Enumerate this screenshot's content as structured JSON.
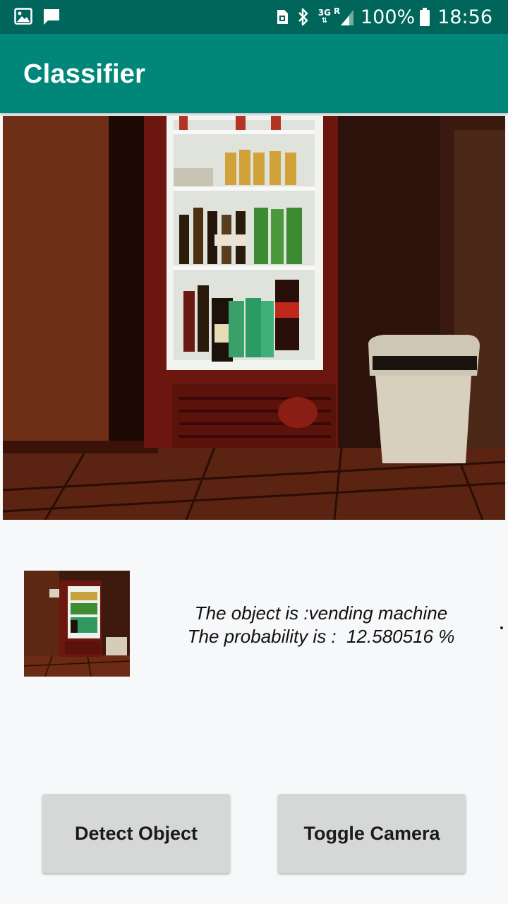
{
  "status_bar": {
    "left_icons": [
      "image-icon",
      "message-icon"
    ],
    "right_icons": [
      "sim-icon",
      "bluetooth-icon",
      "network-3g-icon",
      "signal-icon",
      "battery-icon"
    ],
    "network_type": "3G",
    "roaming": "R",
    "battery": "100%",
    "time": "18:56",
    "colors": {
      "background": "#00665b",
      "text": "#ffffff"
    }
  },
  "app_bar": {
    "title": "Classifier",
    "color": "#00877a"
  },
  "camera": {
    "description_icon": "camera-preview"
  },
  "result": {
    "object_line": "The object is :vending machine",
    "probability_line": "The probability is :  12.580516 %",
    "object_label": "vending machine",
    "probability_percent": 12.580516
  },
  "buttons": {
    "detect_label": "Detect Object",
    "toggle_label": "Toggle Camera",
    "color": "#d6d7d7"
  }
}
